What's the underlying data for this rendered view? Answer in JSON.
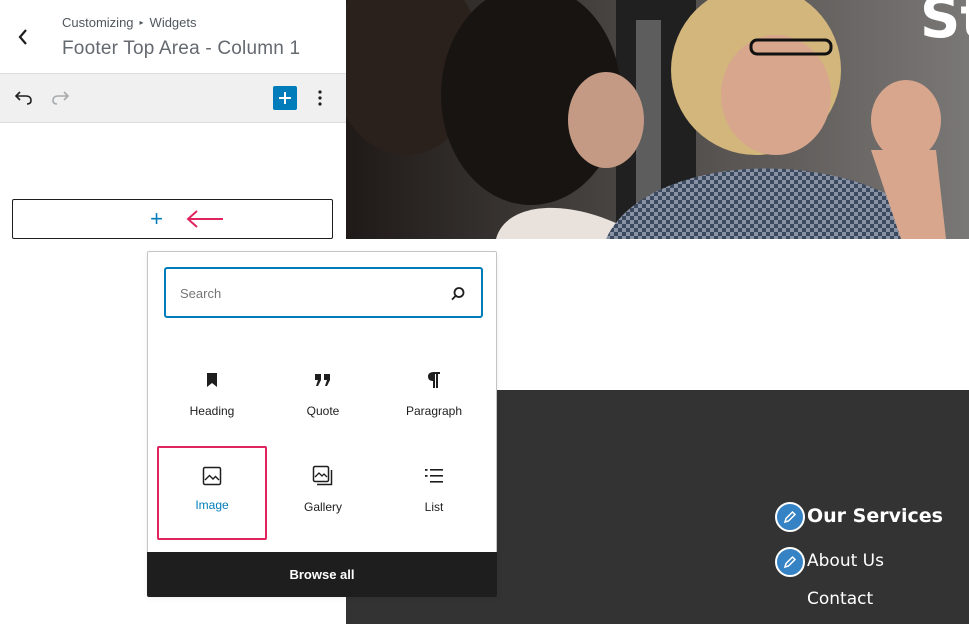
{
  "header": {
    "breadcrumb_parent": "Customizing",
    "breadcrumb_separator": "▸",
    "breadcrumb_current": "Widgets",
    "title": "Footer Top Area - Column 1"
  },
  "toolbar": {
    "undo_icon": "undo-icon",
    "redo_icon": "redo-icon",
    "add_icon": "plus-icon",
    "more_icon": "more-vertical-icon"
  },
  "appender": {
    "plus": "+",
    "annotation_icon": "arrow-left-icon"
  },
  "preview": {
    "hero_title": "St",
    "footer_links": [
      "Our Services",
      "About Us",
      "Contact"
    ]
  },
  "inserter": {
    "search_placeholder": "Search",
    "blocks": [
      {
        "label": "Heading",
        "icon": "bookmark-icon"
      },
      {
        "label": "Quote",
        "icon": "quote-icon"
      },
      {
        "label": "Paragraph",
        "icon": "pilcrow-icon"
      },
      {
        "label": "Image",
        "icon": "image-icon"
      },
      {
        "label": "Gallery",
        "icon": "gallery-icon"
      },
      {
        "label": "List",
        "icon": "list-icon"
      }
    ],
    "browse_all": "Browse all"
  },
  "colors": {
    "accent": "#007cba",
    "highlight": "#e0245e",
    "footer_bg": "#333333",
    "edit_bubble": "#3582c4"
  }
}
